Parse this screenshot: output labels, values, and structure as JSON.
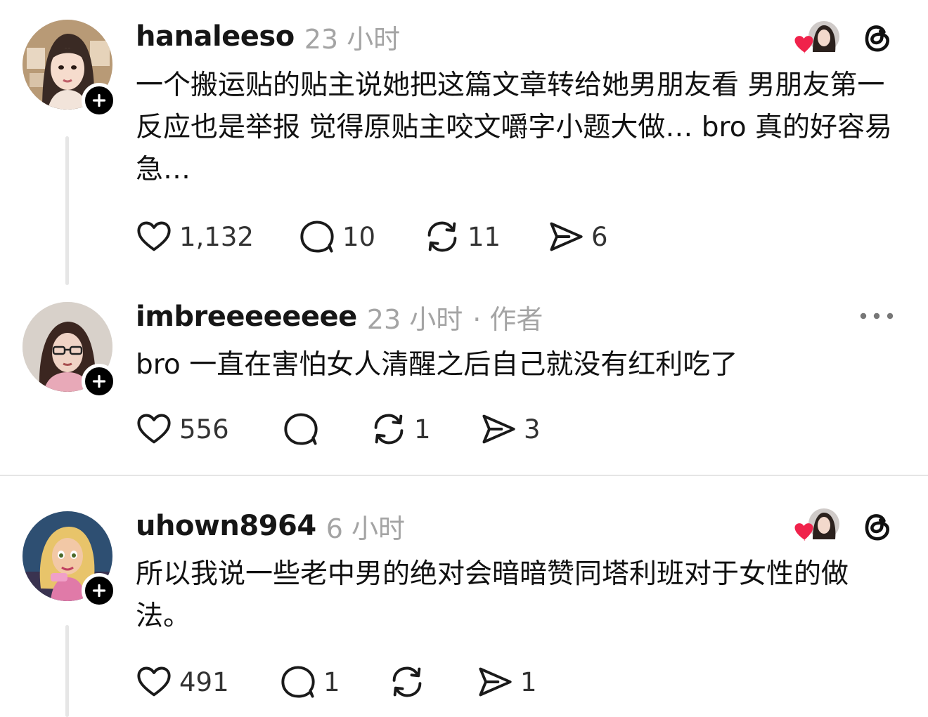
{
  "posts": [
    {
      "username": "hanaleeso",
      "time": "23 小时",
      "author_tag": "",
      "text": "一个搬运贴的贴主说她把这篇文章转给她男朋友看 男朋友第一反应也是举报 觉得原贴主咬文嚼字小题大做… bro 真的好容易急…",
      "likes": "1,132",
      "replies": "10",
      "reposts": "11",
      "shares": "6"
    },
    {
      "username": "imbreeeeeeee",
      "time": "23 小时",
      "author_tag": "· 作者",
      "text": "bro 一直在害怕女人清醒之后自己就没有红利吃了",
      "likes": "556",
      "replies": "",
      "reposts": "1",
      "shares": "3"
    },
    {
      "username": "uhown8964",
      "time": "6 小时",
      "author_tag": "",
      "text": "所以我说一些老中男的绝对会暗暗赞同塔利班对于女性的做法。",
      "likes": "491",
      "replies": "1",
      "reposts": "",
      "shares": "1"
    }
  ],
  "colors": {
    "heart": "#f0224b",
    "icon": "#1a1a1a",
    "meta": "#a4a4a4",
    "thread_line": "#e6e6e6"
  },
  "icons": [
    "heart-outline-icon",
    "comment-bubble-icon",
    "repost-icon",
    "share-arrow-icon",
    "threads-logo-icon",
    "more-dots-icon",
    "plus-icon"
  ]
}
